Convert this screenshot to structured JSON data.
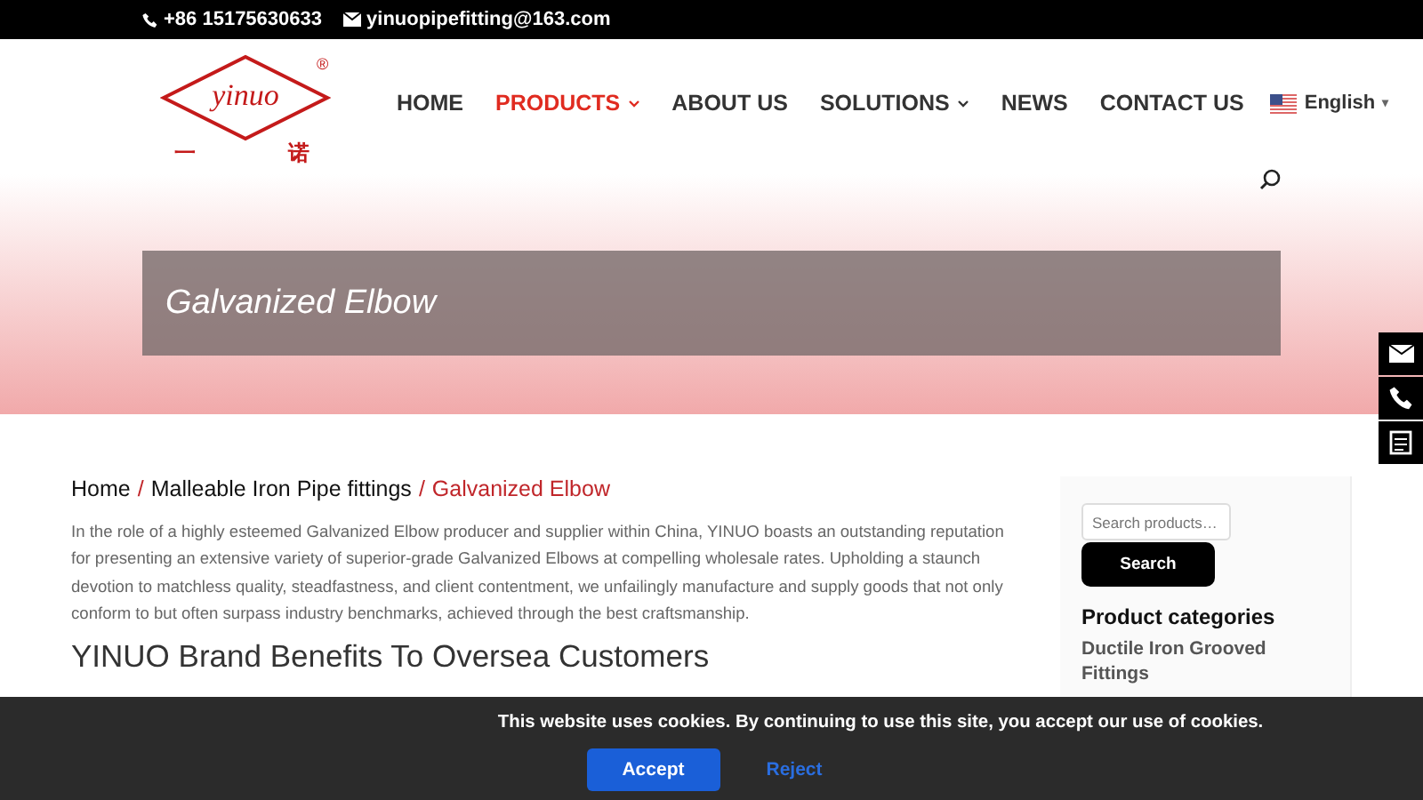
{
  "top_bar": {
    "phone": "+86 15175630633",
    "email": "yinuopipefitting@163.com"
  },
  "logo": {
    "wordmark": "yinuo",
    "registered": "®",
    "left_char": "一",
    "right_char": "诺"
  },
  "nav": [
    {
      "label": "HOME",
      "selected": false,
      "dropdown": false
    },
    {
      "label": "PRODUCTS",
      "selected": true,
      "dropdown": true
    },
    {
      "label": "ABOUT US",
      "selected": false,
      "dropdown": false
    },
    {
      "label": "SOLUTIONS",
      "selected": false,
      "dropdown": true
    },
    {
      "label": "NEWS",
      "selected": false,
      "dropdown": false
    },
    {
      "label": "CONTACT US",
      "selected": false,
      "dropdown": false
    }
  ],
  "language": {
    "label": "English",
    "caret": "▾"
  },
  "hero": {
    "title": "Galvanized Elbow"
  },
  "breadcrumb": [
    {
      "label": "Home",
      "selected": false
    },
    {
      "label": "Malleable Iron Pipe fittings",
      "selected": false
    },
    {
      "label": "Galvanized Elbow",
      "selected": true
    }
  ],
  "breadcrumb_separator": "/",
  "intro": "In the role of a highly esteemed Galvanized Elbow producer and supplier within China, YINUO boasts an outstanding reputation for presenting an extensive variety of superior-grade Galvanized Elbows at compelling wholesale rates. Upholding a staunch devotion to matchless quality, steadfastness, and client contentment, we unfailingly manufacture and supply goods that not only conform to but often surpass industry benchmarks, achieved through the best craftsmanship.",
  "section_heading": "YINUO Brand Benefits To Oversea Customers",
  "sidebar": {
    "search_placeholder": "Search products…",
    "search_button": "Search",
    "categories_title": "Product categories",
    "categories": [
      {
        "label": "Ductile Iron Grooved Fittings"
      }
    ]
  },
  "cookie_bar": {
    "message": "This website uses cookies. By continuing to use this site, you accept our use of cookies.",
    "accept": "Accept",
    "reject": "Reject"
  }
}
